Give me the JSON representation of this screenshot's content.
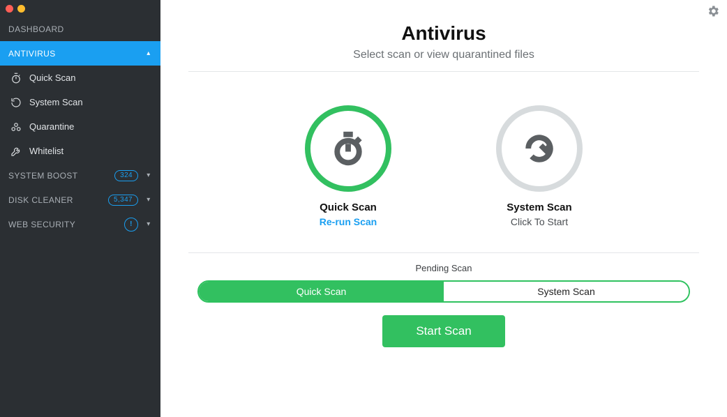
{
  "sidebar": {
    "dashboard": "DASHBOARD",
    "antivirus": "ANTIVIRUS",
    "items": [
      {
        "label": "Quick Scan"
      },
      {
        "label": "System Scan"
      },
      {
        "label": "Quarantine"
      },
      {
        "label": "Whitelist"
      }
    ],
    "system_boost": {
      "label": "SYSTEM BOOST",
      "badge": "324"
    },
    "disk_cleaner": {
      "label": "DISK CLEANER",
      "badge": "5,347"
    },
    "web_security": {
      "label": "WEB SECURITY",
      "badge": "!"
    }
  },
  "header": {
    "title": "Antivirus",
    "subtitle": "Select scan or view quarantined files"
  },
  "cards": {
    "quick": {
      "title": "Quick Scan",
      "sub": "Re-run Scan"
    },
    "system": {
      "title": "System Scan",
      "sub": "Click To Start"
    }
  },
  "pending": {
    "label": "Pending Scan",
    "quick": "Quick Scan",
    "system": "System Scan"
  },
  "start_button": "Start Scan"
}
